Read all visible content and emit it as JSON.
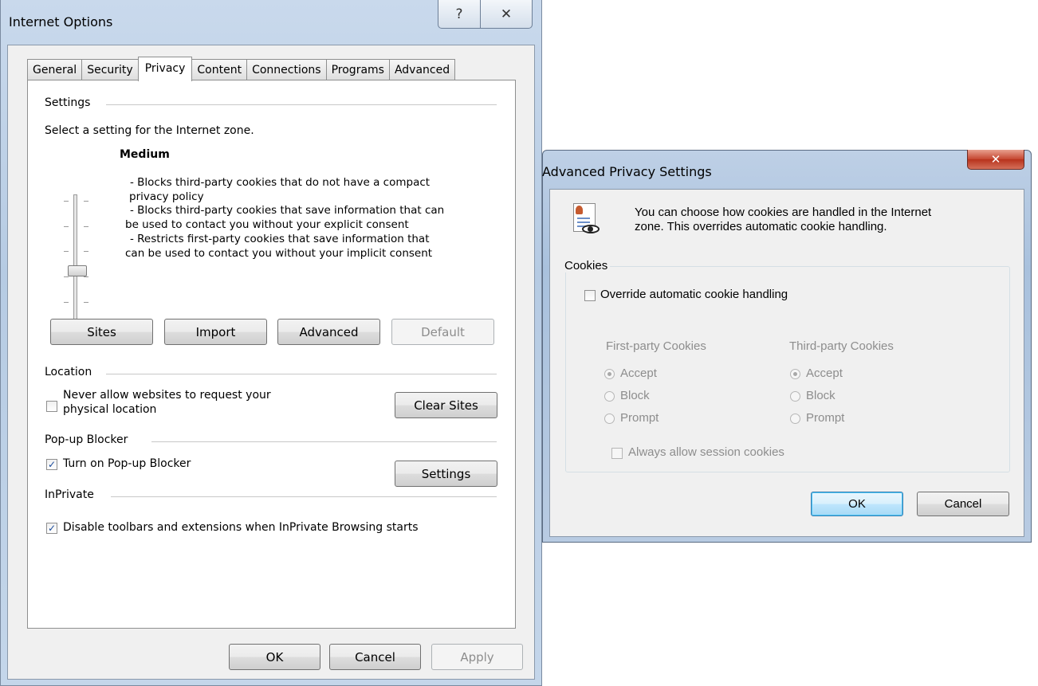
{
  "internet_options": {
    "title": "Internet Options",
    "help_glyph": "?",
    "close_glyph": "✕",
    "tabs": [
      "General",
      "Security",
      "Privacy",
      "Content",
      "Connections",
      "Programs",
      "Advanced"
    ],
    "active_tab": "Privacy",
    "settings": {
      "group_label": "Settings",
      "prompt": "Select a setting for the Internet zone.",
      "level": "Medium",
      "description": [
        "- Blocks third-party cookies that do not have a compact",
        "privacy policy",
        "- Blocks third-party cookies that save information that can",
        "be used to contact you without your explicit consent",
        "- Restricts first-party cookies that save information that",
        "can be used to contact you without your implicit consent"
      ],
      "buttons": {
        "sites": "Sites",
        "import": "Import",
        "advanced": "Advanced",
        "default": "Default"
      }
    },
    "location": {
      "group_label": "Location",
      "checkbox_label_line1": "Never allow websites to request your",
      "checkbox_label_line2": "physical location",
      "checked": false,
      "clear_sites": "Clear Sites"
    },
    "popup_blocker": {
      "group_label": "Pop-up Blocker",
      "checkbox_label": "Turn on Pop-up Blocker",
      "checked": true,
      "settings_button": "Settings"
    },
    "inprivate": {
      "group_label": "InPrivate",
      "checkbox_label": "Disable toolbars and extensions when InPrivate Browsing starts",
      "checked": true
    },
    "footer": {
      "ok": "OK",
      "cancel": "Cancel",
      "apply": "Apply"
    }
  },
  "advanced_privacy": {
    "title": "Advanced Privacy Settings",
    "close_glyph": "✕",
    "info_line1": "You can choose how cookies are handled in the Internet",
    "info_line2": "zone.  This overrides automatic cookie handling.",
    "cookies_label": "Cookies",
    "override_label": "Override automatic cookie handling",
    "override_checked": false,
    "first_party": {
      "label": "First-party Cookies",
      "options": [
        "Accept",
        "Block",
        "Prompt"
      ],
      "selected": "Accept"
    },
    "third_party": {
      "label": "Third-party Cookies",
      "options": [
        "Accept",
        "Block",
        "Prompt"
      ],
      "selected": "Accept"
    },
    "session_label": "Always allow session cookies",
    "session_checked": false,
    "ok": "OK",
    "cancel": "Cancel"
  }
}
